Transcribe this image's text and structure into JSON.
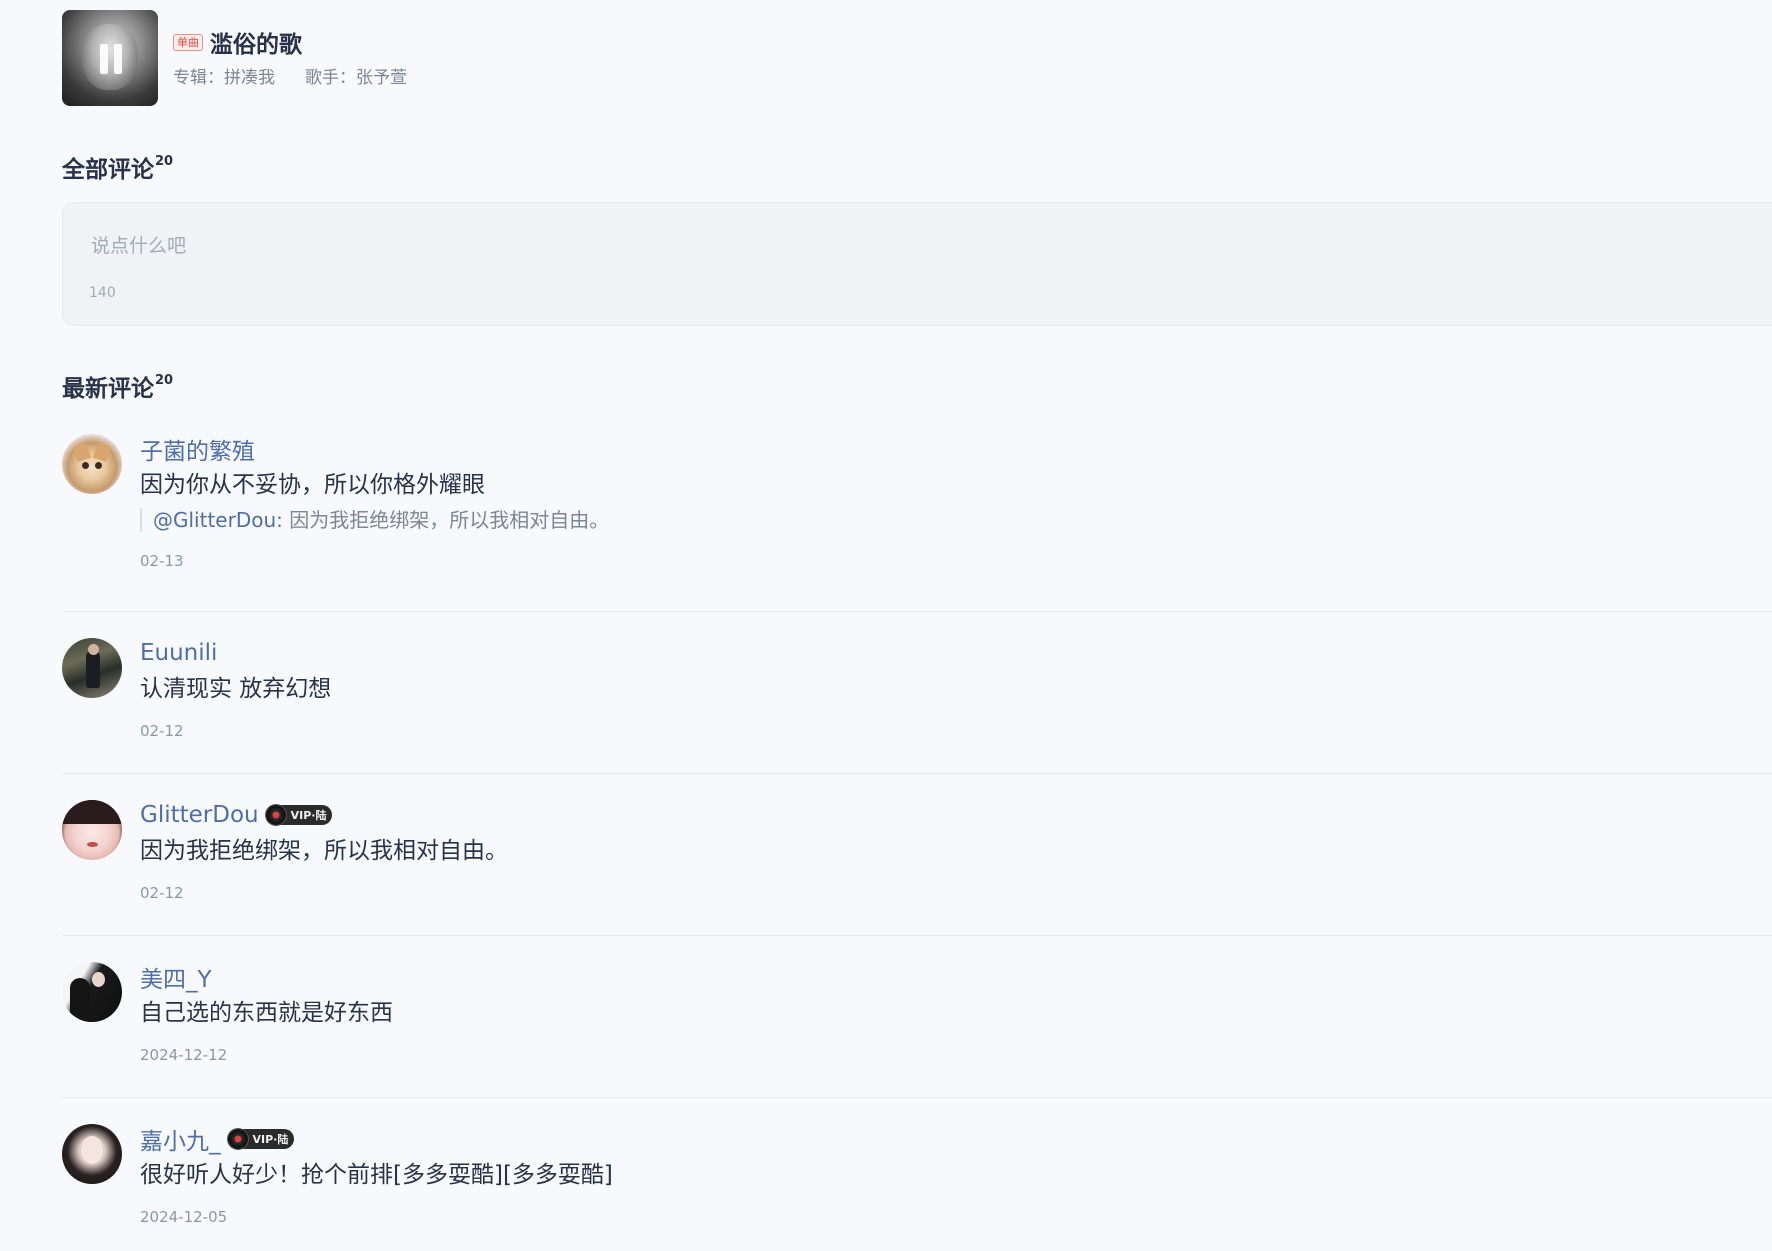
{
  "song": {
    "tag": "单曲",
    "title": "滥俗的歌",
    "album": "专辑：拼凑我",
    "singer": "歌手：张予萱"
  },
  "all_comments": {
    "title": "全部评论",
    "count": "20",
    "input_placeholder": "说点什么吧",
    "char_limit": "140"
  },
  "latest_comments": {
    "title": "最新评论",
    "count": "20"
  },
  "comments": [
    {
      "username": "子菌的繁殖",
      "text": "因为你从不妥协，所以你格外耀眼",
      "quote_user": "@GlitterDou:",
      "quote_text": " 因为我拒绝绑架，所以我相对自由。",
      "date": "02-13",
      "vip": false
    },
    {
      "username": "Euunili",
      "text": "认清现实 放弃幻想",
      "date": "02-12",
      "vip": false
    },
    {
      "username": "GlitterDou",
      "text": "因为我拒绝绑架，所以我相对自由。",
      "date": "02-12",
      "vip": true,
      "vip_label": "VIP·陆"
    },
    {
      "username": "美四_Y",
      "text": "自己选的东西就是好东西",
      "date": "2024-12-12",
      "vip": false
    },
    {
      "username": "嘉小九_",
      "text": "很好听人好少！抢个前排[多多耍酷][多多耍酷]",
      "date": "2024-12-05",
      "vip": true,
      "vip_label": "VIP·陆"
    }
  ],
  "icons": {
    "cover_overlay": "pause-icon",
    "vip": "vinyl-disc-icon"
  },
  "colors": {
    "background": "#f7f9fc",
    "username": "#4e6ea9",
    "text": "#283248",
    "muted": "#7d8596",
    "tag_red": "#e1483d"
  }
}
